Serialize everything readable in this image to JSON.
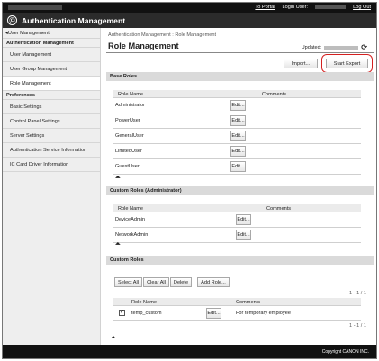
{
  "topbar": {
    "to_portal": "To Portal",
    "login_user_label": "Login User:",
    "log_out": "Log Out"
  },
  "app": {
    "title": "Authentication Management",
    "logo_glyph": "Ⓒ"
  },
  "sidebar": {
    "back": "User Management",
    "group1_head": "Authentication Management",
    "group1_items": [
      "User Management",
      "User Group Management",
      "Role Management"
    ],
    "group2_head": "Preferences",
    "group2_items": [
      "Basic Settings",
      "Control Panel Settings",
      "Server Settings",
      "Authentication Service Information",
      "IC Card Driver Information"
    ]
  },
  "main": {
    "breadcrumb": "Authentication Management : Role Management",
    "title": "Role Management",
    "updated_label": "Updated:",
    "import_label": "Import...",
    "export_label": "Start Export",
    "base_roles": {
      "head": "Base Roles",
      "col_name": "Role Name",
      "col_comments": "Comments",
      "rows": [
        "Administrator",
        "PowerUser",
        "GeneralUser",
        "LimitedUser",
        "GuestUser"
      ]
    },
    "custom_admin": {
      "head": "Custom Roles (Administrator)",
      "col_name": "Role Name",
      "col_comments": "Comments",
      "rows": [
        "DeviceAdmin",
        "NetworkAdmin"
      ]
    },
    "custom_roles": {
      "head": "Custom Roles",
      "select_all": "Select All",
      "clear_all": "Clear All",
      "delete": "Delete",
      "add_role": "Add Role...",
      "pager_top": "1 - 1 / 1",
      "pager_bottom": "1 - 1 / 1",
      "col_name": "Role Name",
      "col_comments": "Comments",
      "rows": [
        {
          "name": "temp_custom",
          "comment": "For temporary employee",
          "checked": true
        }
      ]
    },
    "edit_label": "Edit...",
    "refresh_icon": "⟳",
    "up_icon": "⏶"
  },
  "footer": {
    "copyright": "Copyright CANON INC."
  }
}
